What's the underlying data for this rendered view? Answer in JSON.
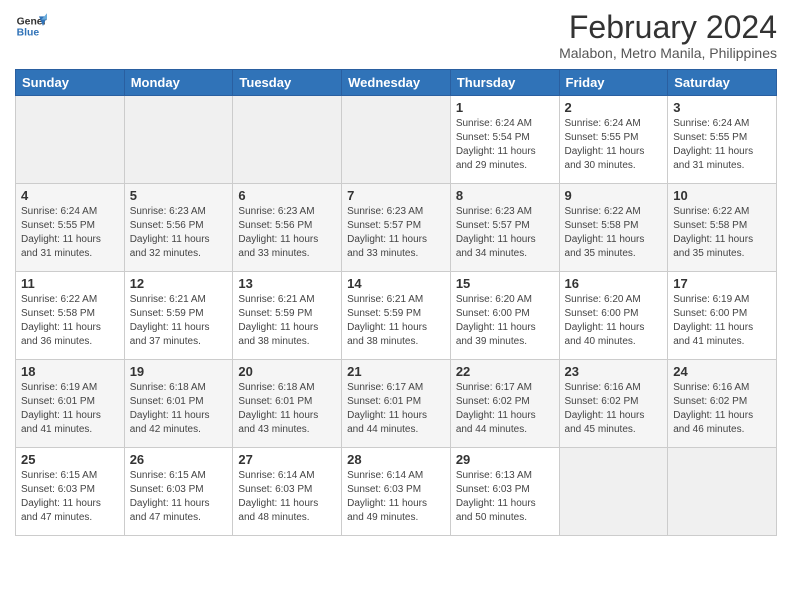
{
  "header": {
    "logo_line1": "General",
    "logo_line2": "Blue",
    "title": "February 2024",
    "subtitle": "Malabon, Metro Manila, Philippines"
  },
  "weekdays": [
    "Sunday",
    "Monday",
    "Tuesday",
    "Wednesday",
    "Thursday",
    "Friday",
    "Saturday"
  ],
  "weeks": [
    [
      {
        "num": "",
        "info": ""
      },
      {
        "num": "",
        "info": ""
      },
      {
        "num": "",
        "info": ""
      },
      {
        "num": "",
        "info": ""
      },
      {
        "num": "1",
        "info": "Sunrise: 6:24 AM\nSunset: 5:54 PM\nDaylight: 11 hours\nand 29 minutes."
      },
      {
        "num": "2",
        "info": "Sunrise: 6:24 AM\nSunset: 5:55 PM\nDaylight: 11 hours\nand 30 minutes."
      },
      {
        "num": "3",
        "info": "Sunrise: 6:24 AM\nSunset: 5:55 PM\nDaylight: 11 hours\nand 31 minutes."
      }
    ],
    [
      {
        "num": "4",
        "info": "Sunrise: 6:24 AM\nSunset: 5:55 PM\nDaylight: 11 hours\nand 31 minutes."
      },
      {
        "num": "5",
        "info": "Sunrise: 6:23 AM\nSunset: 5:56 PM\nDaylight: 11 hours\nand 32 minutes."
      },
      {
        "num": "6",
        "info": "Sunrise: 6:23 AM\nSunset: 5:56 PM\nDaylight: 11 hours\nand 33 minutes."
      },
      {
        "num": "7",
        "info": "Sunrise: 6:23 AM\nSunset: 5:57 PM\nDaylight: 11 hours\nand 33 minutes."
      },
      {
        "num": "8",
        "info": "Sunrise: 6:23 AM\nSunset: 5:57 PM\nDaylight: 11 hours\nand 34 minutes."
      },
      {
        "num": "9",
        "info": "Sunrise: 6:22 AM\nSunset: 5:58 PM\nDaylight: 11 hours\nand 35 minutes."
      },
      {
        "num": "10",
        "info": "Sunrise: 6:22 AM\nSunset: 5:58 PM\nDaylight: 11 hours\nand 35 minutes."
      }
    ],
    [
      {
        "num": "11",
        "info": "Sunrise: 6:22 AM\nSunset: 5:58 PM\nDaylight: 11 hours\nand 36 minutes."
      },
      {
        "num": "12",
        "info": "Sunrise: 6:21 AM\nSunset: 5:59 PM\nDaylight: 11 hours\nand 37 minutes."
      },
      {
        "num": "13",
        "info": "Sunrise: 6:21 AM\nSunset: 5:59 PM\nDaylight: 11 hours\nand 38 minutes."
      },
      {
        "num": "14",
        "info": "Sunrise: 6:21 AM\nSunset: 5:59 PM\nDaylight: 11 hours\nand 38 minutes."
      },
      {
        "num": "15",
        "info": "Sunrise: 6:20 AM\nSunset: 6:00 PM\nDaylight: 11 hours\nand 39 minutes."
      },
      {
        "num": "16",
        "info": "Sunrise: 6:20 AM\nSunset: 6:00 PM\nDaylight: 11 hours\nand 40 minutes."
      },
      {
        "num": "17",
        "info": "Sunrise: 6:19 AM\nSunset: 6:00 PM\nDaylight: 11 hours\nand 41 minutes."
      }
    ],
    [
      {
        "num": "18",
        "info": "Sunrise: 6:19 AM\nSunset: 6:01 PM\nDaylight: 11 hours\nand 41 minutes."
      },
      {
        "num": "19",
        "info": "Sunrise: 6:18 AM\nSunset: 6:01 PM\nDaylight: 11 hours\nand 42 minutes."
      },
      {
        "num": "20",
        "info": "Sunrise: 6:18 AM\nSunset: 6:01 PM\nDaylight: 11 hours\nand 43 minutes."
      },
      {
        "num": "21",
        "info": "Sunrise: 6:17 AM\nSunset: 6:01 PM\nDaylight: 11 hours\nand 44 minutes."
      },
      {
        "num": "22",
        "info": "Sunrise: 6:17 AM\nSunset: 6:02 PM\nDaylight: 11 hours\nand 44 minutes."
      },
      {
        "num": "23",
        "info": "Sunrise: 6:16 AM\nSunset: 6:02 PM\nDaylight: 11 hours\nand 45 minutes."
      },
      {
        "num": "24",
        "info": "Sunrise: 6:16 AM\nSunset: 6:02 PM\nDaylight: 11 hours\nand 46 minutes."
      }
    ],
    [
      {
        "num": "25",
        "info": "Sunrise: 6:15 AM\nSunset: 6:03 PM\nDaylight: 11 hours\nand 47 minutes."
      },
      {
        "num": "26",
        "info": "Sunrise: 6:15 AM\nSunset: 6:03 PM\nDaylight: 11 hours\nand 47 minutes."
      },
      {
        "num": "27",
        "info": "Sunrise: 6:14 AM\nSunset: 6:03 PM\nDaylight: 11 hours\nand 48 minutes."
      },
      {
        "num": "28",
        "info": "Sunrise: 6:14 AM\nSunset: 6:03 PM\nDaylight: 11 hours\nand 49 minutes."
      },
      {
        "num": "29",
        "info": "Sunrise: 6:13 AM\nSunset: 6:03 PM\nDaylight: 11 hours\nand 50 minutes."
      },
      {
        "num": "",
        "info": ""
      },
      {
        "num": "",
        "info": ""
      }
    ]
  ]
}
